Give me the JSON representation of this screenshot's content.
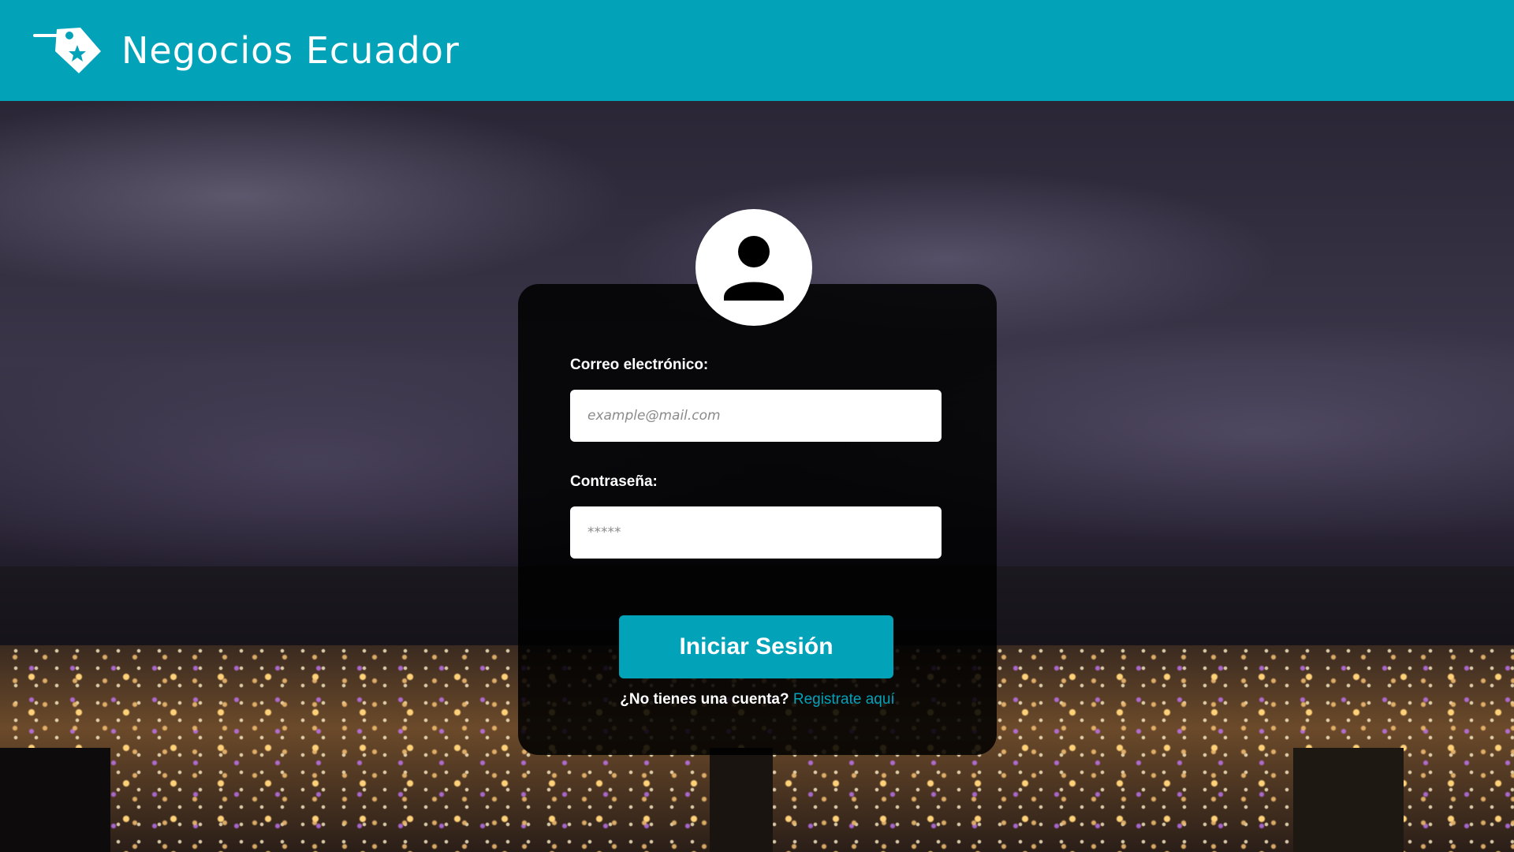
{
  "header": {
    "brand": "Negocios Ecuador",
    "logo_icon": "price-tag-star-icon",
    "color": "#02a2b9"
  },
  "login": {
    "avatar_icon": "user-icon",
    "email_label": "Correo electrónico:",
    "email_placeholder": "example@mail.com",
    "email_value": "",
    "password_label": "Contraseña:",
    "password_placeholder": "*****",
    "password_value": "",
    "submit_label": "Iniciar Sesión",
    "signup_prompt": "¿No tienes una cuenta?",
    "signup_link": "Registrate aquí"
  }
}
